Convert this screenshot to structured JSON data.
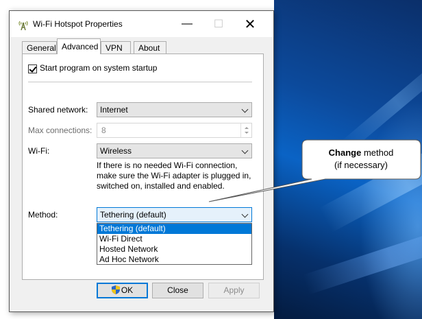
{
  "window": {
    "title": "Wi-Fi Hotspot Properties",
    "controls": {
      "minimize": "—",
      "maximize": "☐",
      "close": "✕"
    }
  },
  "tabs": [
    {
      "label": "General",
      "active": false
    },
    {
      "label": "Advanced",
      "active": true
    },
    {
      "label": "VPN",
      "active": false
    },
    {
      "label": "About",
      "active": false
    }
  ],
  "startup": {
    "label": "Start program on system startup",
    "checked": true
  },
  "shared_network": {
    "label": "Shared network:",
    "value": "Internet"
  },
  "max_connections": {
    "label": "Max connections:",
    "value": "8"
  },
  "wifi": {
    "label": "Wi-Fi:",
    "value": "Wireless",
    "hint": "If there is no needed Wi-Fi connection, make sure the Wi-Fi adapter is plugged in, switched on, installed and enabled."
  },
  "method": {
    "label": "Method:",
    "value": "Tethering (default)",
    "options": [
      "Tethering (default)",
      "Wi-Fi Direct",
      "Hosted Network",
      "Ad Hoc Network"
    ],
    "selected_index": 0
  },
  "buttons": {
    "ok": "OK",
    "close": "Close",
    "apply": "Apply"
  },
  "callout": {
    "bold": "Change",
    "rest": " method",
    "line2": "(if necessary)"
  },
  "colors": {
    "accent": "#0078d7",
    "selection": "#0078d7"
  }
}
